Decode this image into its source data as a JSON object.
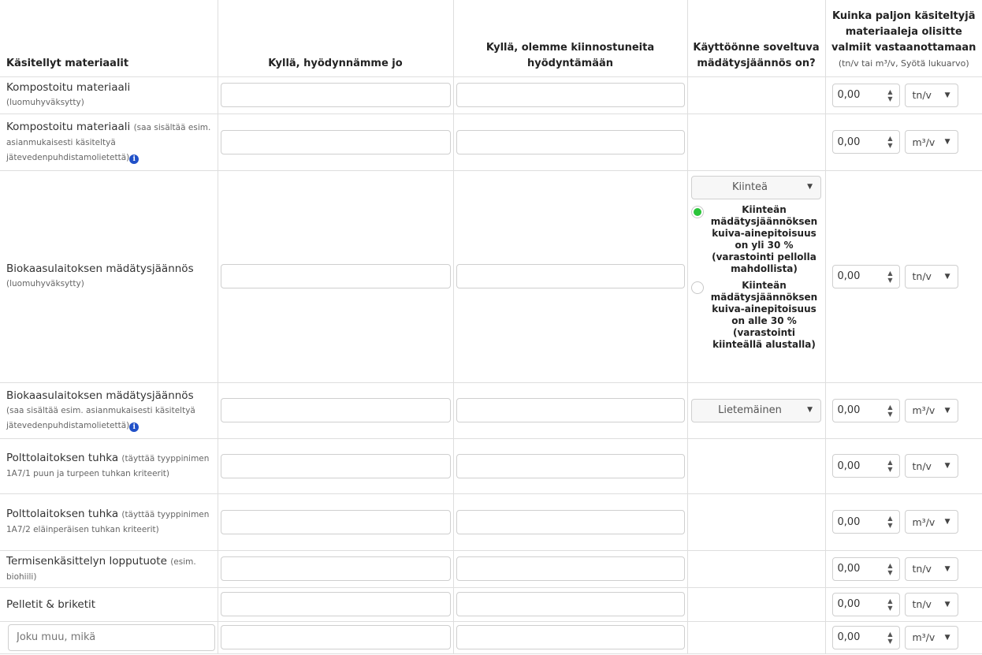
{
  "headers": {
    "material": "Käsitellyt materiaalit",
    "using": "Kyllä, hyödynnämme jo",
    "interested": "Kyllä, olemme kiinnostuneita hyödyntämään",
    "usage_form": "Käyttöönne soveltuva mädätysjäännös on?",
    "quantity_bold": "Kuinka paljon käsiteltyjä materiaaleja olisitte valmiit vastaanottamaan",
    "quantity_note": "(tn/v tai m³/v, Syötä lukuarvo)"
  },
  "rows": [
    {
      "name": "Kompostoitu materiaali",
      "note": "(luomuhyväksytty)",
      "value": "0,00",
      "unit": "tn/v"
    },
    {
      "name": "Kompostoitu materiaali",
      "note": "(saa sisältää esim. asianmukaisesti käsiteltyä jätevedenpuhdistamolietettä)",
      "value": "0,00",
      "unit": "m³/v"
    },
    {
      "name": "Biokaasulaitoksen mädätysjäännös",
      "note": "(luomuhyväksytty)",
      "value": "0,00",
      "unit": "tn/v",
      "select": "Kiinteä",
      "options": [
        {
          "text": "Kiinteän mädätysjäännöksen kuiva-ainepitoisuus on yli 30 % (varastointi pellolla mahdollista)",
          "selected": true
        },
        {
          "text": "Kiinteän mädätysjäännöksen kuiva-ainepitoisuus on alle 30 % (varastointi kiinteällä alustalla)",
          "selected": false
        }
      ]
    },
    {
      "name": "Biokaasulaitoksen mädätysjäännös",
      "note": "(saa sisältää esim. asianmukaisesti käsiteltyä jätevedenpuhdistamolietettä)",
      "value": "0,00",
      "unit": "m³/v",
      "select": "Lietemäinen"
    },
    {
      "name": "Polttolaitoksen tuhka",
      "note": "(täyttää tyyppinimen 1A7/1 puun ja turpeen tuhkan kriteerit)",
      "value": "0,00",
      "unit": "tn/v"
    },
    {
      "name": "Polttolaitoksen tuhka",
      "note": "(täyttää tyyppinimen 1A7/2 eläinperäisen tuhkan kriteerit)",
      "value": "0,00",
      "unit": "m³/v"
    },
    {
      "name": "Termisenkäsittelyn lopputuote",
      "note": "(esim. biohiili)",
      "value": "0,00",
      "unit": "tn/v"
    },
    {
      "name": "Pelletit & briketit",
      "note": "",
      "value": "0,00",
      "unit": "tn/v"
    },
    {
      "name": "",
      "note": "",
      "placeholder": "Joku muu, mikä",
      "value": "0,00",
      "unit": "m³/v"
    }
  ]
}
